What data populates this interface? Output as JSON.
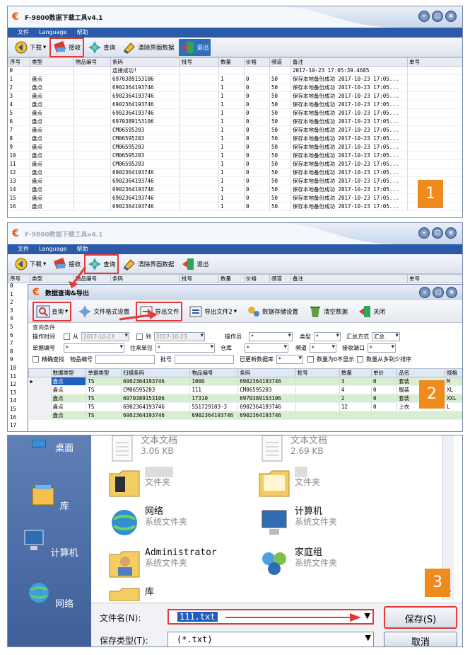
{
  "panel1": {
    "title": "F-9800数据下载工具v4.1",
    "menu": [
      "文件",
      "Language",
      "帮助"
    ],
    "toolbar": {
      "download": "下载",
      "receive": "接收",
      "query": "查询",
      "clear": "清除界面数据",
      "exit": "退出"
    },
    "columns": [
      "序号",
      "类型",
      "物品编号",
      "条码",
      "批号",
      "数量",
      "价格",
      "频道",
      "备注",
      "单号"
    ],
    "rows": [
      [
        "0",
        "",
        "",
        "连接成功!",
        "",
        "",
        "",
        "",
        "2017-10-23 17:05:39.4685",
        ""
      ],
      [
        "1",
        "盘点",
        "",
        "6970389153106",
        "",
        "1",
        "0",
        "50",
        "保存本地备份成功 2017-10-23 17:05...",
        ""
      ],
      [
        "2",
        "盘点",
        "",
        "6902364193746",
        "",
        "1",
        "0",
        "50",
        "保存本地备份成功 2017-10-23 17:05...",
        ""
      ],
      [
        "3",
        "盘点",
        "",
        "6902364193746",
        "",
        "1",
        "0",
        "50",
        "保存本地备份成功 2017-10-23 17:05...",
        ""
      ],
      [
        "4",
        "盘点",
        "",
        "6902364193746",
        "",
        "1",
        "0",
        "50",
        "保存本地备份成功 2017-10-23 17:05...",
        ""
      ],
      [
        "5",
        "盘点",
        "",
        "6902364193746",
        "",
        "1",
        "0",
        "50",
        "保存本地备份成功 2017-10-23 17:05...",
        ""
      ],
      [
        "6",
        "盘点",
        "",
        "6970389153106",
        "",
        "1",
        "0",
        "50",
        "保存本地备份成功 2017-10-23 17:05...",
        ""
      ],
      [
        "7",
        "盘点",
        "",
        "CM06595203",
        "",
        "1",
        "0",
        "50",
        "保存本地备份成功 2017-10-23 17:05...",
        ""
      ],
      [
        "8",
        "盘点",
        "",
        "CM06595203",
        "",
        "1",
        "0",
        "50",
        "保存本地备份成功 2017-10-23 17:05...",
        ""
      ],
      [
        "9",
        "盘点",
        "",
        "CM06595203",
        "",
        "1",
        "0",
        "50",
        "保存本地备份成功 2017-10-23 17:05...",
        ""
      ],
      [
        "10",
        "盘点",
        "",
        "CM06595203",
        "",
        "1",
        "0",
        "50",
        "保存本地备份成功 2017-10-23 17:05...",
        ""
      ],
      [
        "11",
        "盘点",
        "",
        "CM06595203",
        "",
        "1",
        "0",
        "50",
        "保存本地备份成功 2017-10-23 17:05...",
        ""
      ],
      [
        "12",
        "盘点",
        "",
        "6902364193746",
        "",
        "1",
        "0",
        "50",
        "保存本地备份成功 2017-10-23 17:05...",
        ""
      ],
      [
        "13",
        "盘点",
        "",
        "6902364193746",
        "",
        "1",
        "0",
        "50",
        "保存本地备份成功 2017-10-23 17:05...",
        ""
      ],
      [
        "14",
        "盘点",
        "",
        "6902364193746",
        "",
        "1",
        "0",
        "50",
        "保存本地备份成功 2017-10-23 17:05...",
        ""
      ],
      [
        "15",
        "盘点",
        "",
        "6902364193746",
        "",
        "1",
        "0",
        "50",
        "保存本地备份成功 2017-10-23 17:05...",
        ""
      ],
      [
        "16",
        "盘点",
        "",
        "6902364193746",
        "",
        "1",
        "0",
        "50",
        "保存本地备份成功 2017-10-23 17:05...",
        ""
      ]
    ],
    "badge": "1"
  },
  "panel2": {
    "title": "F-9800数据下载工具v4.1",
    "menu": [
      "文件",
      "Language",
      "帮助"
    ],
    "toolbar": {
      "download": "下载",
      "receive": "接收",
      "query": "查询",
      "clear": "清除界面数据",
      "exit": "退出"
    },
    "columns": [
      "序号",
      "类型",
      "物品编号",
      "条码",
      "批号",
      "数量",
      "价格",
      "频道",
      "备注",
      "单号"
    ],
    "row_numbers": [
      "0",
      "1",
      "2",
      "3",
      "4",
      "5",
      "6",
      "7",
      "8",
      "9",
      "10",
      "11",
      "12",
      "13",
      "14",
      "15",
      "16",
      "17"
    ],
    "dialog": {
      "title": "数据查询&导出",
      "toolbar": {
        "query": "查询",
        "file_format": "文件格式设置",
        "export1": "导出文件",
        "export2": "导出文件2",
        "storage": "数据存储设置",
        "clear": "清空数据",
        "close": "关闭"
      },
      "filter_group": "查询条件",
      "labels": {
        "op_time": "操作时间",
        "from": "从",
        "to": "到",
        "operator": "操作员",
        "type": "类型",
        "summary": "汇总方式",
        "doc_no": "单据编号",
        "partner": "往来单位",
        "warehouse": "仓库",
        "channel": "频道",
        "port": "接收端口",
        "exact": "精确查找",
        "item_no": "物品编号",
        "batch": "批号",
        "exported": "已更新数据库",
        "qty_hidden": "数量为0不显示",
        "qty_sort": "数量从多到少排序"
      },
      "values": {
        "from_date": "2017-10-23",
        "to_date": "2017-10-23",
        "operator": "*",
        "type": "*",
        "summary": "汇总",
        "doc_no": "*",
        "partner": "*",
        "warehouse": "*",
        "channel": "*",
        "port": "*",
        "exported": "*"
      },
      "columns": [
        "数据类型",
        "单据类型",
        "扫描条码",
        "物品编号",
        "条码",
        "批号",
        "数量",
        "单价",
        "品名",
        "规格"
      ],
      "rows": [
        [
          "盘点",
          "TS",
          "6902364193746",
          "1000",
          "6902364193746",
          "",
          "3",
          "0",
          "套装",
          "M"
        ],
        [
          "盘点",
          "TS",
          "CM06595203",
          "111",
          "CM06595203",
          "",
          "4",
          "0",
          "服装",
          "XL"
        ],
        [
          "盘点",
          "TS",
          "6970389153106",
          "17310",
          "6970389153106",
          "",
          "2",
          "0",
          "套装",
          "XXL"
        ],
        [
          "盘点",
          "TS",
          "6902364193746",
          "551729103-3",
          "6902364193746",
          "",
          "12",
          "0",
          "上衣",
          "L"
        ],
        [
          "盘点",
          "TS",
          "6902364193746",
          "6902364193746",
          "6902364193746",
          "",
          "",
          "",
          "",
          ""
        ]
      ]
    },
    "badge": "2"
  },
  "panel3": {
    "nav": [
      "桌面",
      "库",
      "计算机",
      "网络"
    ],
    "files": [
      {
        "name": "文本文档",
        "sub": "3.06 KB"
      },
      {
        "name": "文本文档",
        "sub": "2.69 KB"
      },
      {
        "name": "",
        "sub": "文件夹"
      },
      {
        "name": "",
        "sub": "文件夹"
      },
      {
        "name": "网络",
        "sub": "系统文件夹"
      },
      {
        "name": "计算机",
        "sub": "系统文件夹"
      },
      {
        "name": "Administrator",
        "sub": "系统文件夹"
      },
      {
        "name": "家庭组",
        "sub": "系统文件夹"
      },
      {
        "name": "库",
        "sub": ""
      }
    ],
    "filename_label": "文件名(N):",
    "filename_value": "111.txt",
    "filetype_label": "保存类型(T):",
    "filetype_value": "(*.txt)",
    "save": "保存(S)",
    "cancel": "取消",
    "badge": "3"
  }
}
